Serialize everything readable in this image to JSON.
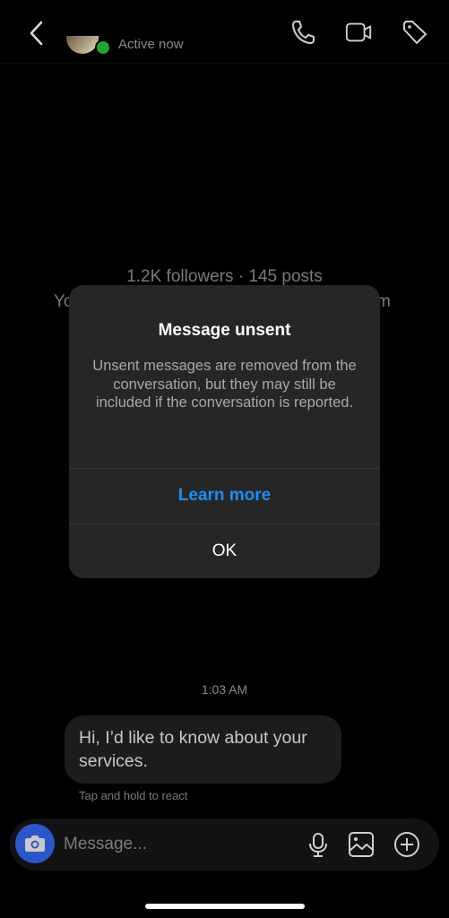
{
  "header": {
    "status": "Active now",
    "status_color": "#1fa82e",
    "icons": [
      "back-chevron-icon",
      "phone-icon",
      "video-camera-icon",
      "tag-icon"
    ]
  },
  "profile": {
    "stats": "1.2K followers · 145 posts",
    "line2_left": "Yo",
    "line2_right": "m"
  },
  "dialog": {
    "title": "Message unsent",
    "body": "Unsent messages are removed from the conversation, but they may still be included if the conversation is reported.",
    "learn_more": "Learn more",
    "learn_more_color": "#1c8ef0",
    "ok": "OK"
  },
  "conversation": {
    "timestamp": "1:03 AM",
    "messages": [
      {
        "text": "Hi, I’d like to know about your services."
      }
    ],
    "react_hint": "Tap and hold to react"
  },
  "composer": {
    "placeholder": "Message...",
    "camera_color": "#2c57c9",
    "icons": [
      "camera-icon",
      "microphone-icon",
      "gallery-icon",
      "plus-circle-icon"
    ]
  }
}
